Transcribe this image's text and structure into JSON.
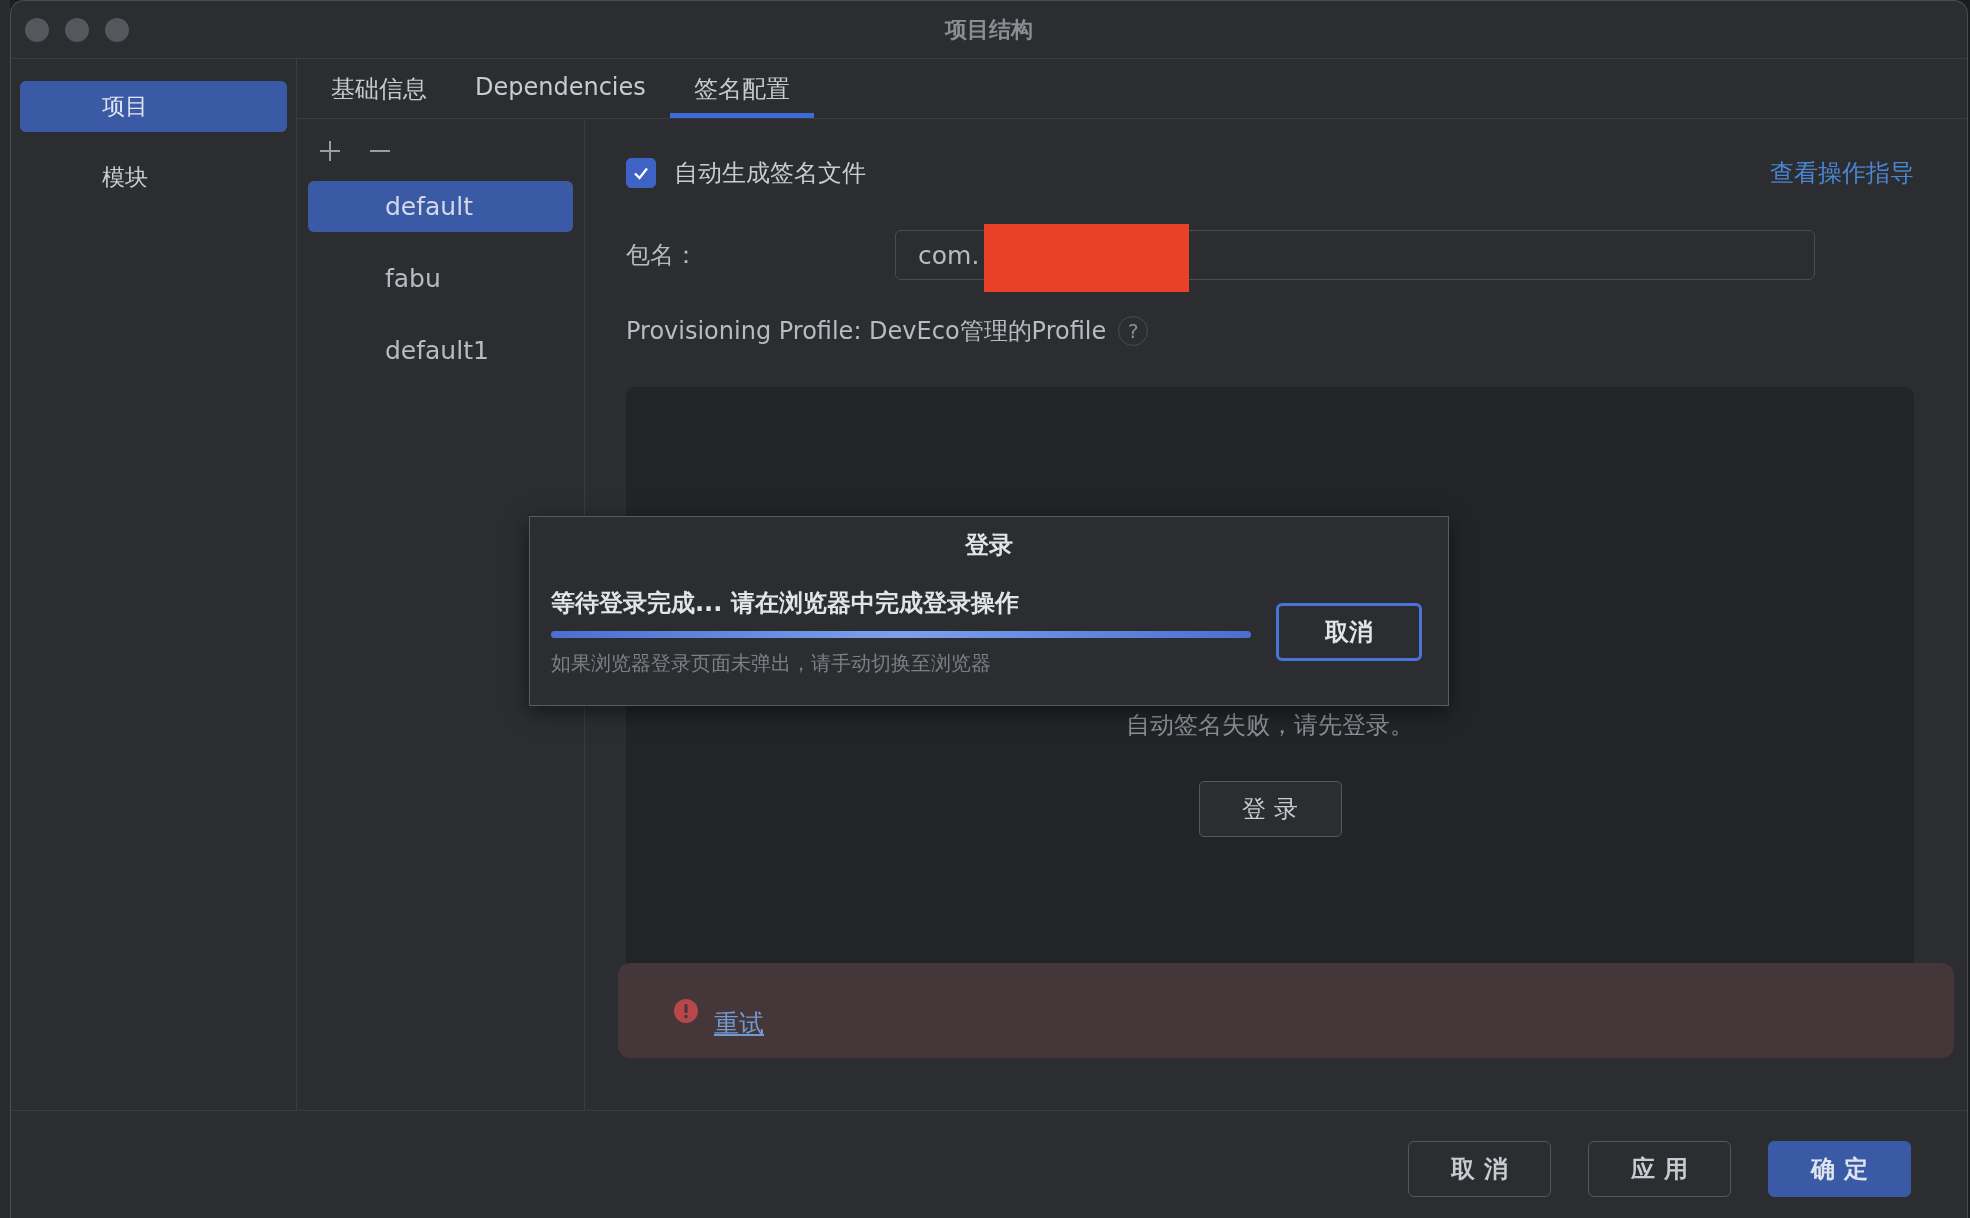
{
  "window": {
    "title": "项目结构"
  },
  "sidebar": {
    "items": [
      {
        "label": "项目",
        "selected": true
      },
      {
        "label": "模块",
        "selected": false
      }
    ]
  },
  "tabs": [
    {
      "label": "基础信息",
      "selected": false
    },
    {
      "label": "Dependencies",
      "selected": false
    },
    {
      "label": "签名配置",
      "selected": true
    }
  ],
  "configs": [
    {
      "label": "default",
      "selected": true
    },
    {
      "label": "fabu",
      "selected": false
    },
    {
      "label": "default1",
      "selected": false
    }
  ],
  "auto_generate": {
    "label": "自动生成签名文件",
    "checked": true
  },
  "guide_link": "查看操作指导",
  "package_name": {
    "label": "包名：",
    "value": "com.",
    "redacted": true
  },
  "profile": {
    "label": "Provisioning Profile: DevEco管理的Profile",
    "help": "?"
  },
  "status_panel": {
    "message": "自动签名失败，请先登录。",
    "button": "登 录"
  },
  "error_bar": {
    "link": "重试"
  },
  "footer_buttons": [
    {
      "label": "取 消",
      "kind": "secondary"
    },
    {
      "label": "应 用",
      "kind": "secondary"
    },
    {
      "label": "确 定",
      "kind": "primary"
    }
  ],
  "login_dialog": {
    "title": "登录",
    "message": "等待登录完成... 请在浏览器中完成登录操作",
    "level": 1,
    "hint": "如果浏览器登录页面未弹出，请手动切换至浏览器",
    "button": "取消"
  }
}
